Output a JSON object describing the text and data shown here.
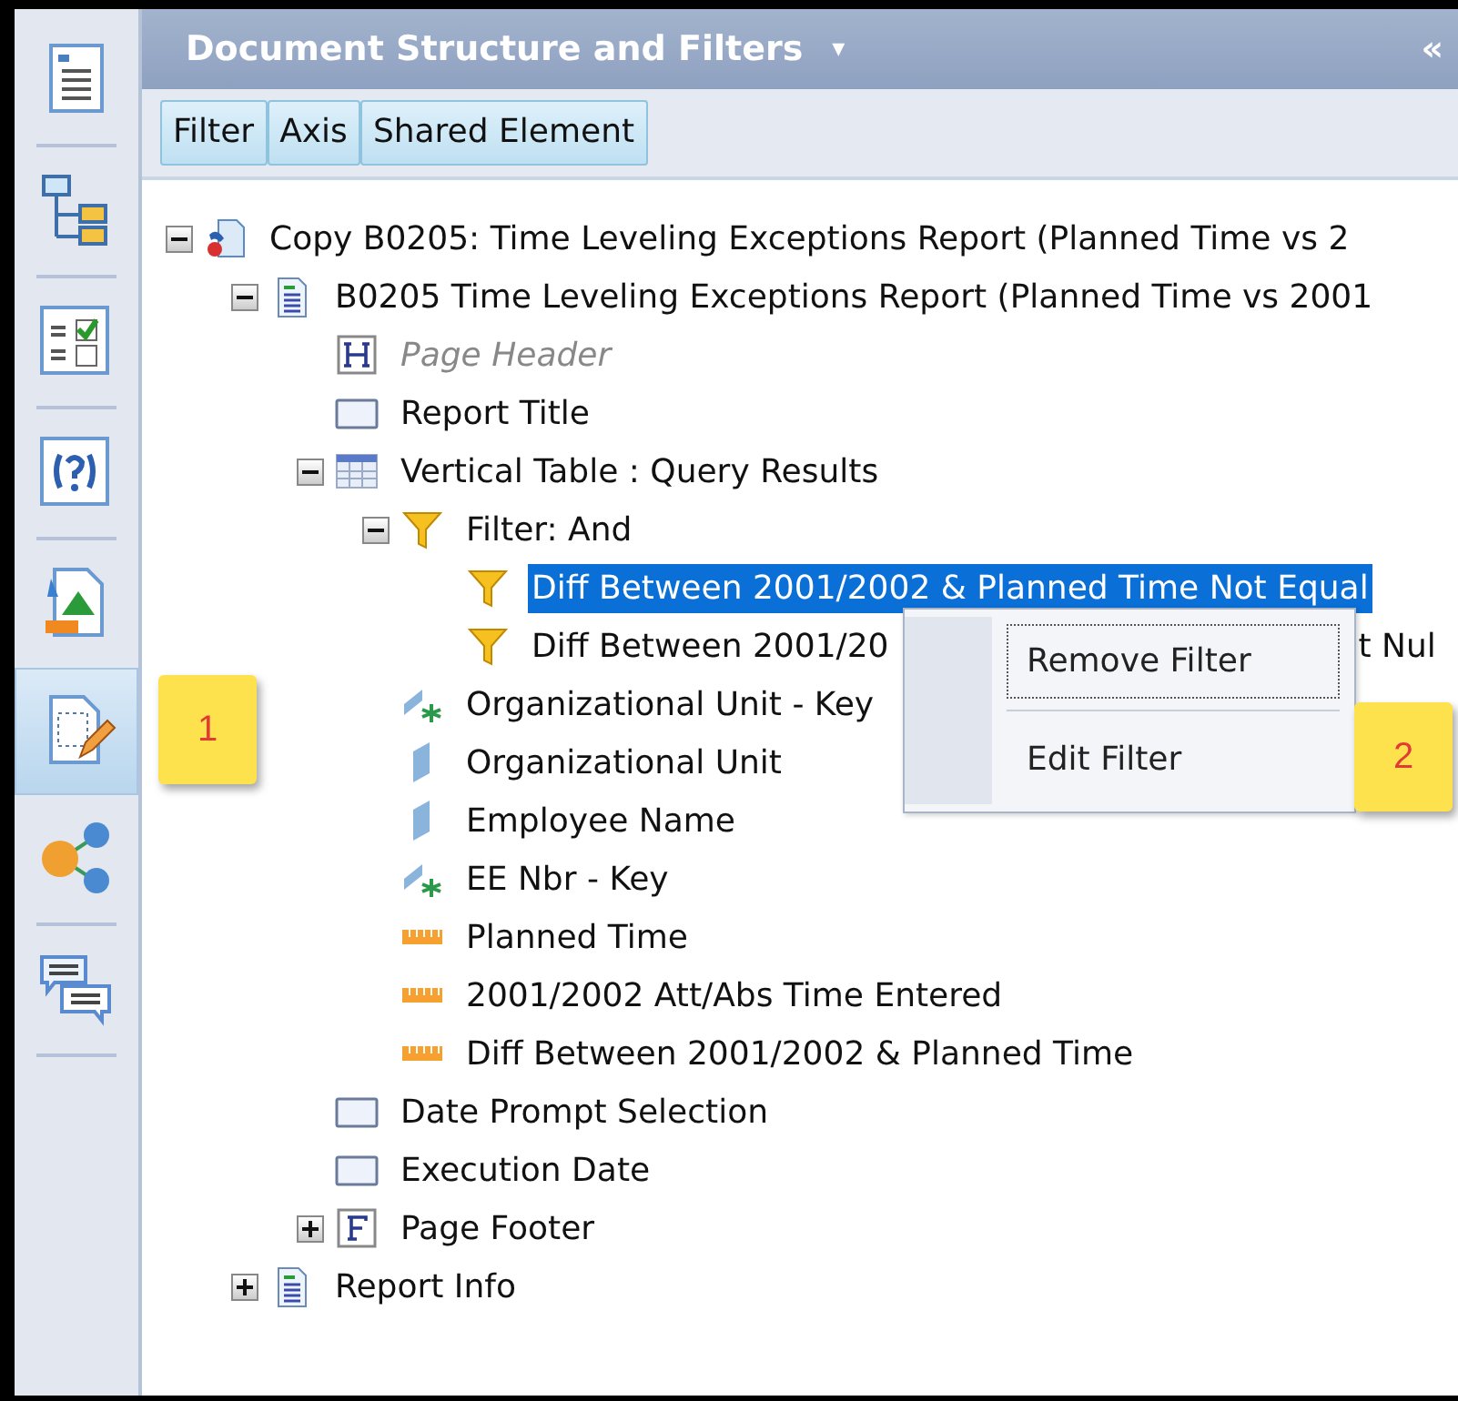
{
  "sidebar": {
    "items": [
      {
        "kind": "document",
        "selected": false,
        "divider_after": true
      },
      {
        "kind": "hierarchy",
        "selected": false,
        "divider_after": true
      },
      {
        "kind": "checklist",
        "selected": false,
        "divider_after": true
      },
      {
        "kind": "help",
        "selected": false,
        "divider_after": true
      },
      {
        "kind": "chart-doc",
        "selected": false,
        "divider_after": false
      },
      {
        "kind": "edit-doc",
        "selected": true,
        "divider_after": false,
        "callout": "1"
      },
      {
        "kind": "share",
        "selected": false,
        "divider_after": true
      },
      {
        "kind": "comments",
        "selected": false,
        "divider_after": true
      }
    ]
  },
  "panel": {
    "title": "Document Structure and Filters",
    "menu_glyph": "▾",
    "collapse_glyph": "«",
    "tabs": [
      "Filter",
      "Axis",
      "Shared Element"
    ],
    "tree": [
      {
        "kind": "copy-doc",
        "label": "Copy B0205: Time Leveling Exceptions Report (Planned Time vs 2",
        "expanded": true,
        "children": [
          {
            "kind": "report",
            "label": "B0205 Time Leveling Exceptions Report (Planned Time vs 2001",
            "expanded": true,
            "children": [
              {
                "kind": "header",
                "label": "Page Header",
                "italic": true
              },
              {
                "kind": "cell",
                "label": "Report Title"
              },
              {
                "kind": "table",
                "label": "Vertical Table : Query Results",
                "expanded": true,
                "children": [
                  {
                    "kind": "filter",
                    "label": "Filter: And",
                    "expanded": true,
                    "children": [
                      {
                        "kind": "filter",
                        "label": "Diff Between 2001/2002 & Planned Time Not Equal",
                        "selected": true
                      },
                      {
                        "kind": "filter",
                        "label": "Diff Between 2001/20",
                        "label_tail": "t Nul",
                        "selected": false
                      }
                    ]
                  },
                  {
                    "kind": "key",
                    "label": "Organizational Unit - Key"
                  },
                  {
                    "kind": "dimension",
                    "label": "Organizational Unit"
                  },
                  {
                    "kind": "dimension",
                    "label": "Employee Name"
                  },
                  {
                    "kind": "key",
                    "label": "EE Nbr - Key"
                  },
                  {
                    "kind": "measure",
                    "label": "Planned Time"
                  },
                  {
                    "kind": "measure",
                    "label": "2001/2002 Att/Abs Time Entered"
                  },
                  {
                    "kind": "measure",
                    "label": "Diff Between 2001/2002 & Planned Time"
                  }
                ]
              },
              {
                "kind": "cell",
                "label": "Date Prompt Selection"
              },
              {
                "kind": "cell",
                "label": "Execution Date"
              },
              {
                "kind": "footer",
                "label": "Page Footer",
                "expanded": false
              }
            ]
          },
          {
            "kind": "report",
            "label": "Report Info",
            "expanded": false
          }
        ]
      }
    ]
  },
  "context_menu": {
    "items": [
      {
        "label": "Remove Filter",
        "focused": true
      },
      {
        "label": "Edit Filter",
        "focused": false,
        "callout": "2"
      }
    ]
  }
}
